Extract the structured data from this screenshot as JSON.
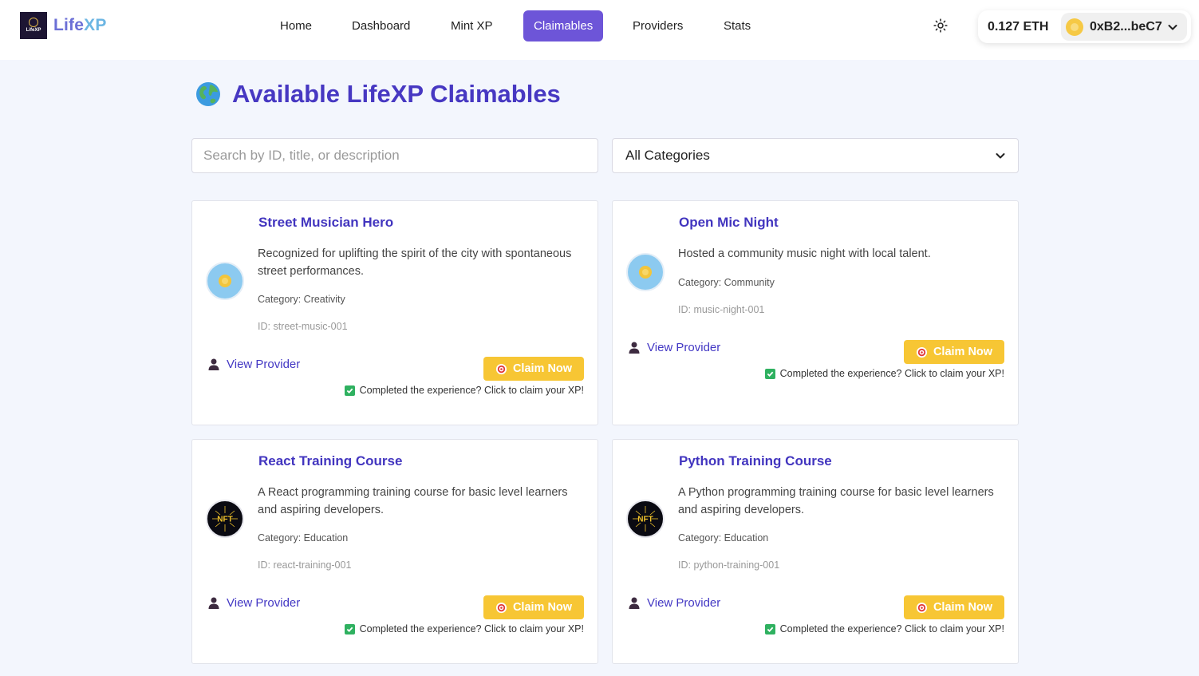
{
  "header": {
    "brand": {
      "logo_text": "LifeXP",
      "name_part1": "Life",
      "name_part2": "XP"
    },
    "nav": [
      {
        "label": "Home",
        "active": false
      },
      {
        "label": "Dashboard",
        "active": false
      },
      {
        "label": "Mint XP",
        "active": false
      },
      {
        "label": "Claimables",
        "active": true
      },
      {
        "label": "Providers",
        "active": false
      },
      {
        "label": "Stats",
        "active": false
      }
    ],
    "theme_icon": "sun-icon",
    "wallet": {
      "balance": "0.127 ETH",
      "address": "0xB2...beC7"
    }
  },
  "main": {
    "title": "Available LifeXP Claimables",
    "title_icon": "globe-icon",
    "search": {
      "placeholder": "Search by ID, title, or description",
      "value": ""
    },
    "category_filter": {
      "selected": "All Categories"
    }
  },
  "claimables": [
    {
      "title": "Street Musician Hero",
      "description": "Recognized for uplifting the spirit of the city with spontaneous street performances.",
      "category": "Category: Creativity",
      "id": "ID: street-music-001",
      "icon": "coin-icon"
    },
    {
      "title": "Open Mic Night",
      "description": "Hosted a community music night with local talent.",
      "category": "Category: Community",
      "id": "ID: music-night-001",
      "icon": "coin-icon"
    },
    {
      "title": "React Training Course",
      "description": "A React programming training course for basic level learners and aspiring developers.",
      "category": "Category: Education",
      "id": "ID: react-training-001",
      "icon": "nft-icon"
    },
    {
      "title": "Python Training Course",
      "description": "A Python programming training course for basic level learners and aspiring developers.",
      "category": "Category: Education",
      "id": "ID: python-training-001",
      "icon": "nft-icon"
    }
  ],
  "card_labels": {
    "view_provider": "View Provider",
    "claim_button": "Claim Now",
    "claim_hint": "Completed the experience? Click to claim your XP!"
  },
  "colors": {
    "primary": "#6d55d8",
    "title": "#4738c2",
    "claim": "#f7c634",
    "check": "#2fb160",
    "background": "#f3f6fd"
  }
}
